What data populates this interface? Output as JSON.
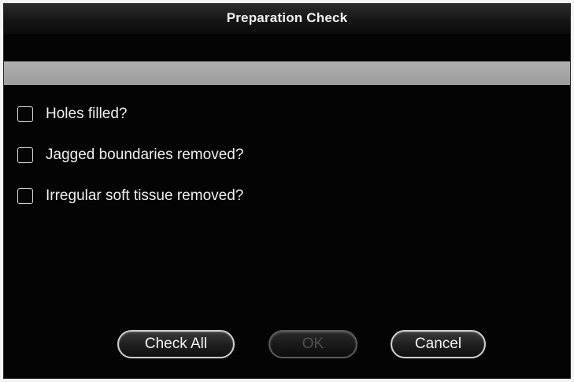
{
  "dialog": {
    "title": "Preparation Check"
  },
  "checklist": {
    "items": [
      {
        "label": "Holes filled?",
        "checked": false
      },
      {
        "label": "Jagged boundaries removed?",
        "checked": false
      },
      {
        "label": "Irregular soft tissue removed?",
        "checked": false
      }
    ]
  },
  "buttons": {
    "check_all": "Check All",
    "ok": "OK",
    "ok_enabled": false,
    "cancel": "Cancel"
  }
}
